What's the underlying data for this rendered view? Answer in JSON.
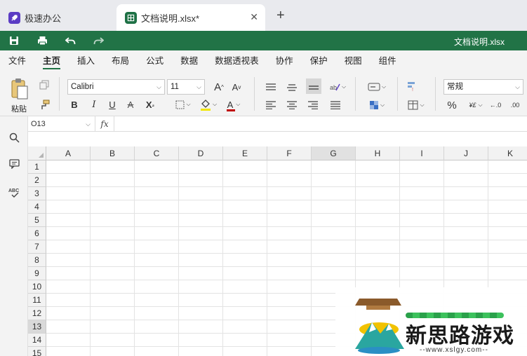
{
  "tabs": [
    {
      "label": "极速办公",
      "icon": "rocket-icon",
      "active": false
    },
    {
      "label": "文档说明.xlsx*",
      "icon": "spreadsheet-icon",
      "active": true
    }
  ],
  "titlebar": {
    "document_title": "文档说明.xlsx"
  },
  "menu": [
    "文件",
    "主页",
    "插入",
    "布局",
    "公式",
    "数据",
    "数据透视表",
    "协作",
    "保护",
    "视图",
    "组件"
  ],
  "ribbon": {
    "paste_label": "粘贴",
    "font_name": "Calibri",
    "font_size": "11",
    "number_format": "常规"
  },
  "formula_bar": {
    "name_box": "O13",
    "fx_label": "fx",
    "formula": ""
  },
  "columns": [
    "A",
    "B",
    "C",
    "D",
    "E",
    "F",
    "G",
    "H",
    "I",
    "J",
    "K"
  ],
  "selected_column": "G",
  "rows": [
    "1",
    "2",
    "3",
    "4",
    "5",
    "6",
    "7",
    "8",
    "9",
    "10",
    "11",
    "12",
    "13",
    "14",
    "15"
  ],
  "selected_row": "13",
  "watermark": {
    "text": "新思路游戏",
    "url": "--www.xslgy.com--"
  },
  "colors": {
    "green": "#217346",
    "accent": "#5b3cc4"
  }
}
